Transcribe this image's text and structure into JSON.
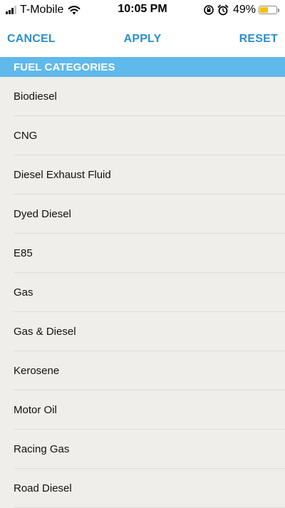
{
  "status_bar": {
    "carrier": "T-Mobile",
    "time": "10:05 PM",
    "battery_percent": "49%",
    "battery_level": 0.49,
    "signal_bars_on": 3,
    "signal_bars_total": 4,
    "battery_color": "#f2c200"
  },
  "nav": {
    "cancel_label": "CANCEL",
    "apply_label": "APPLY",
    "reset_label": "RESET",
    "accent_color": "#2b8fce"
  },
  "section": {
    "title": "FUEL CATEGORIES",
    "color": "#5fb9eb"
  },
  "fuel_categories": [
    {
      "label": "Biodiesel"
    },
    {
      "label": "CNG"
    },
    {
      "label": "Diesel Exhaust Fluid"
    },
    {
      "label": "Dyed Diesel"
    },
    {
      "label": "E85"
    },
    {
      "label": "Gas"
    },
    {
      "label": "Gas & Diesel"
    },
    {
      "label": "Kerosene"
    },
    {
      "label": "Motor Oil"
    },
    {
      "label": "Racing Gas"
    },
    {
      "label": "Road Diesel"
    }
  ],
  "icons": {
    "wifi": "wifi-icon",
    "orientation_lock": "orientation-lock-icon",
    "alarm": "alarm-icon",
    "battery": "battery-icon"
  }
}
